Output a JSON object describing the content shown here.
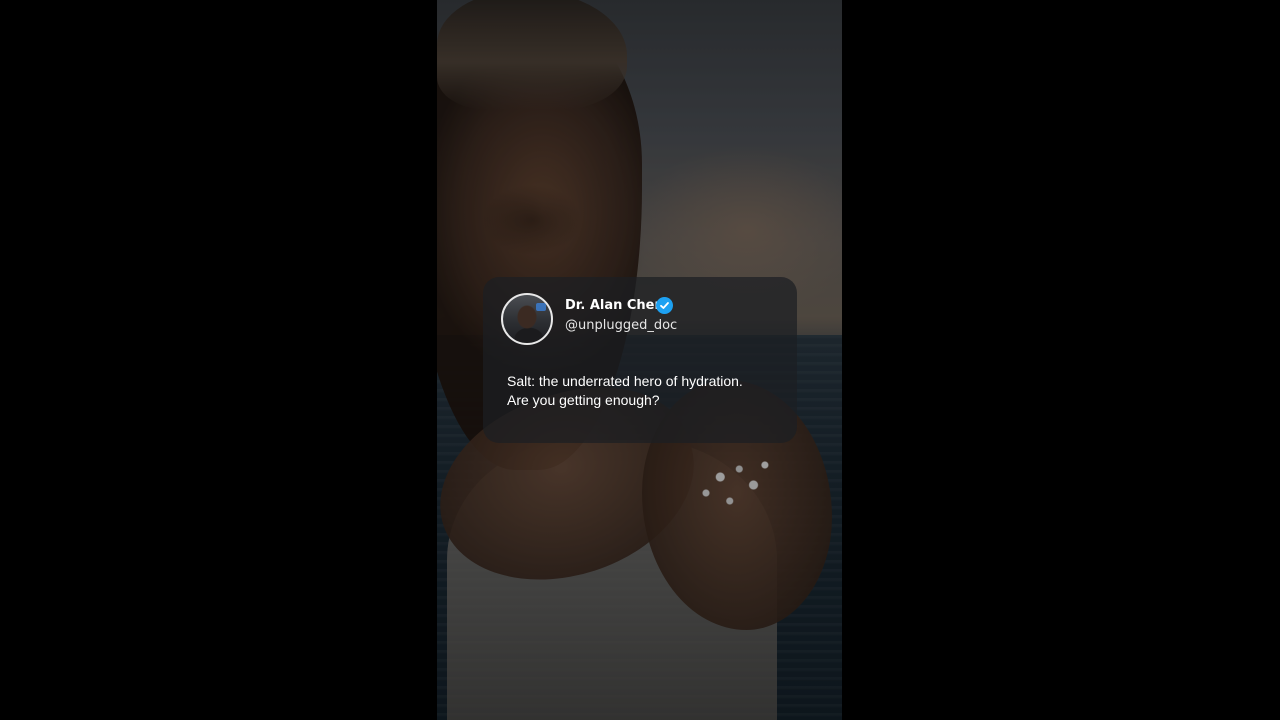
{
  "post": {
    "display_name": "Dr. Alan Chen",
    "handle": "@unplugged_doc",
    "verified": true,
    "text_lines": [
      "Salt: the underrated hero of hydration.",
      "Are you getting enough?"
    ]
  },
  "icons": {
    "verified": "verified-badge-icon",
    "avatar": "profile-photo"
  },
  "colors": {
    "background": "#000000",
    "card": "rgba(28,30,34,0.72)",
    "verified_badge": "#1da1f2",
    "text": "#ffffff"
  }
}
